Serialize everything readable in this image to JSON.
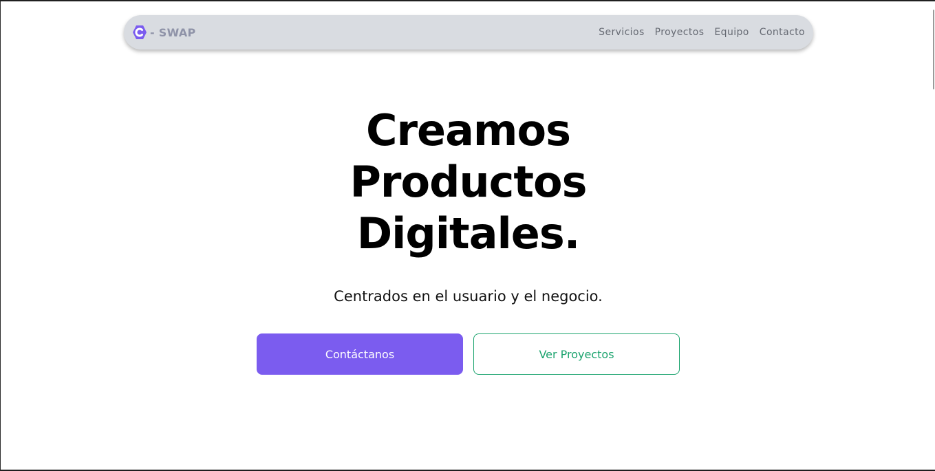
{
  "nav": {
    "brand": {
      "logo_icon": "hexagon-c-logo-icon",
      "text": "- SWAP"
    },
    "links": [
      "Servicios",
      "Proyectos",
      "Equipo",
      "Contacto"
    ]
  },
  "hero": {
    "title_lines": [
      "Creamos",
      "Productos",
      "Digitales."
    ],
    "subtitle": "Centrados en el usuario y el negocio.",
    "primary_button": "Contáctanos",
    "secondary_button": "Ver Proyectos"
  },
  "colors": {
    "accent_purple": "#7b5cef",
    "accent_green": "#1aa36d",
    "nav_background": "#d9dce1",
    "brand_text": "#8f93a8"
  }
}
